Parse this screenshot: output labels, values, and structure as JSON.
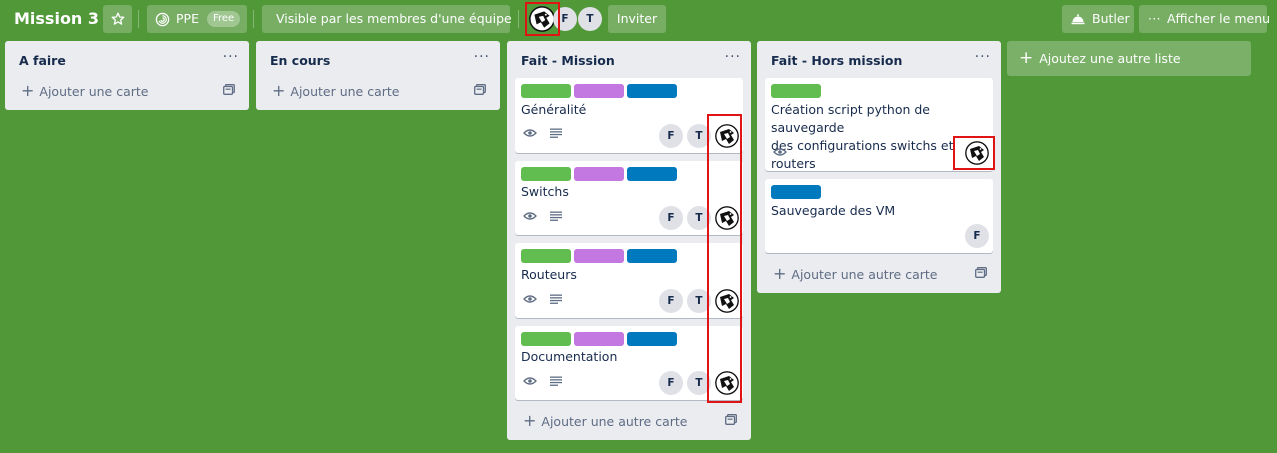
{
  "header": {
    "board_title": "Mission 3",
    "star_icon": "star-icon",
    "team_name": "PPE",
    "team_badge": "Free",
    "visibility_label": "Visible par les membres d'une équipe",
    "members": [
      "F",
      "T"
    ],
    "invite_label": "Inviter",
    "butler_label": "Butler",
    "menu_label": "Afficher le menu"
  },
  "lists": [
    {
      "title": "A faire",
      "menu": "···",
      "add_card": "Ajouter une carte"
    },
    {
      "title": "En cours",
      "menu": "···",
      "add_card": "Ajouter une carte"
    },
    {
      "title": "Fait - Mission",
      "menu": "···",
      "add_card": "Ajouter une autre carte",
      "cards": [
        {
          "title": "Généralité",
          "members": [
            "F",
            "T"
          ]
        },
        {
          "title": "Switchs",
          "members": [
            "F",
            "T"
          ]
        },
        {
          "title": "Routeurs",
          "members": [
            "F",
            "T"
          ]
        },
        {
          "title": "Documentation",
          "members": [
            "F",
            "T"
          ]
        }
      ]
    },
    {
      "title": "Fait - Hors mission",
      "menu": "···",
      "add_card": "Ajouter une autre carte",
      "cards": [
        {
          "title_line1": "Création script python de sauvegarde",
          "title_line2": "des configurations switchs et routers"
        },
        {
          "title": "Sauvegarde des VM",
          "members": [
            "F"
          ]
        }
      ]
    }
  ],
  "add_list_label": "Ajoutez une autre liste",
  "colors": {
    "board_bg": "#519839",
    "label_green": "#61bd4f",
    "label_purple": "#c377e0",
    "label_blue": "#0079bf",
    "highlight": "#e01414"
  }
}
